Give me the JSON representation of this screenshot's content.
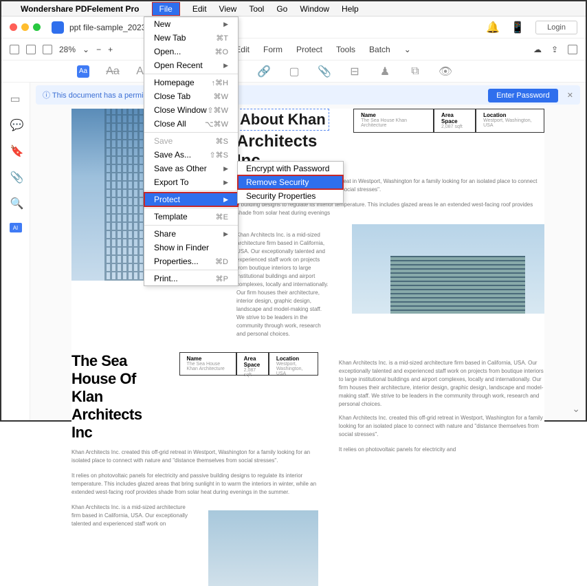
{
  "menubar": {
    "app": "Wondershare PDFelement Pro",
    "items": [
      "File",
      "Edit",
      "View",
      "Tool",
      "Go",
      "Window",
      "Help"
    ]
  },
  "window": {
    "tab_title": "ppt file-sample_2023_0",
    "login": "Login"
  },
  "toolbar": {
    "zoom": "28%",
    "tabs": [
      "Edit",
      "Form",
      "Protect",
      "Tools",
      "Batch"
    ]
  },
  "ribbon_first": "Aa",
  "permission": {
    "text": "This document has a permission pa",
    "button": "Enter Password"
  },
  "file_menu": {
    "new": "New",
    "newtab": "New Tab",
    "newtab_sc": "⌘T",
    "open": "Open...",
    "open_sc": "⌘O",
    "recent": "Open Recent",
    "homepage": "Homepage",
    "homepage_sc": "↑⌘H",
    "closetab": "Close Tab",
    "closetab_sc": "⌘W",
    "closewin": "Close Window",
    "closewin_sc": "⇧⌘W",
    "closeall": "Close All",
    "closeall_sc": "⌥⌘W",
    "save": "Save",
    "save_sc": "⌘S",
    "saveas": "Save As...",
    "saveas_sc": "⇧⌘S",
    "saveother": "Save as Other",
    "export": "Export To",
    "protect": "Protect",
    "template": "Template",
    "template_sc": "⌘E",
    "share": "Share",
    "showfinder": "Show in Finder",
    "properties": "Properties...",
    "properties_sc": "⌘D",
    "print": "Print...",
    "print_sc": "⌘P"
  },
  "protect_submenu": {
    "encrypt": "Encrypt with Password",
    "remove": "Remove Security",
    "props": "Security Properties"
  },
  "doc": {
    "line1": "About Khan",
    "line2": "Architects Inc.",
    "info": {
      "h1": "Name",
      "h2": "Area Space",
      "h3": "Location",
      "v1": "The Sea House Khan Architecture",
      "v2": "2,087 sqft",
      "v3": "Westport, Washington, USA"
    },
    "p1": "Khan Architects Inc. created this off-grid retreat in Westport, Washington for a family looking for an isolated place to connect with nature and \"distance themselves from social stresses\".",
    "p2": "e building designs to regulate its interior temperature. This includes glazed areas le an extended west-facing roof provides shade from solar heat during evenings",
    "p3": "Khan Architects Inc. is a mid-sized architecture firm based in California, USA. Our exceptionally talented and experienced staff work on projects from boutique interiors to large institutional buildings and airport complexes, locally and internationally. Our firm houses their architecture, interior design, graphic design, landscape and model-making staff. We strive to be leaders in the community through work, research and personal choices.",
    "h2a": "The Sea House Of",
    "h2b": "Klan Architects Inc",
    "p4": "Khan Architects Inc. created this off-grid retreat in Westport, Washington for a family looking for an isolated place to connect with nature and \"distance themselves from social stresses\".",
    "p5": "It relies on photovoltaic panels for electricity and passive building designs to regulate its interior temperature. This includes glazed areas that bring sunlight in to warm the interiors in winter, while an extended west-facing roof provides shade from solar heat during evenings in the summer.",
    "p6": "Khan Architects Inc. is a mid-sized architecture firm based in California, USA. Our exceptionally talented and experienced staff work on projects from boutique interiors to large institutional buildings and airport complexes, locally and internationally. Our firm houses their architecture, interior design, graphic design, landscape and model-making staff. We strive to be leaders in the community through work, research and personal choices.",
    "p7": "Khan Architects Inc. created this off-grid retreat in Westport, Washington for a family looking for an isolated place to connect with nature and \"distance themselves from social stresses\".",
    "p8": "It relies on photovoltaic panels for electricity and",
    "p9": "Khan Architects Inc. is a mid-sized architecture firm based in California, USA. Our exceptionally talented and experienced staff work on"
  },
  "ai": "AI"
}
